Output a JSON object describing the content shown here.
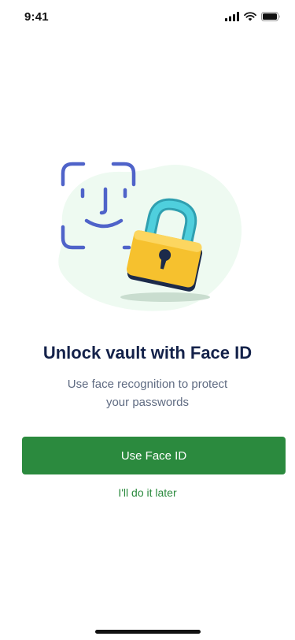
{
  "status_bar": {
    "time": "9:41",
    "icons": [
      "cellular-signal-icon",
      "wifi-icon",
      "battery-icon"
    ]
  },
  "illustration": {
    "icons": [
      "face-id-icon",
      "padlock-icon"
    ],
    "colors": {
      "face_outline": "#4f63c9",
      "blob_background": "#eefaf1",
      "lock_body": "#f6c12e",
      "lock_shackle": "#38b8c9"
    }
  },
  "content": {
    "title": "Unlock vault with Face ID",
    "subtitle": "Use face recognition to protect your passwords"
  },
  "actions": {
    "primary_label": "Use Face ID",
    "secondary_label": "I'll do it later"
  },
  "theme": {
    "accent": "#2b8a3e",
    "title_color": "#14224a",
    "body_color": "#5f6b82"
  }
}
